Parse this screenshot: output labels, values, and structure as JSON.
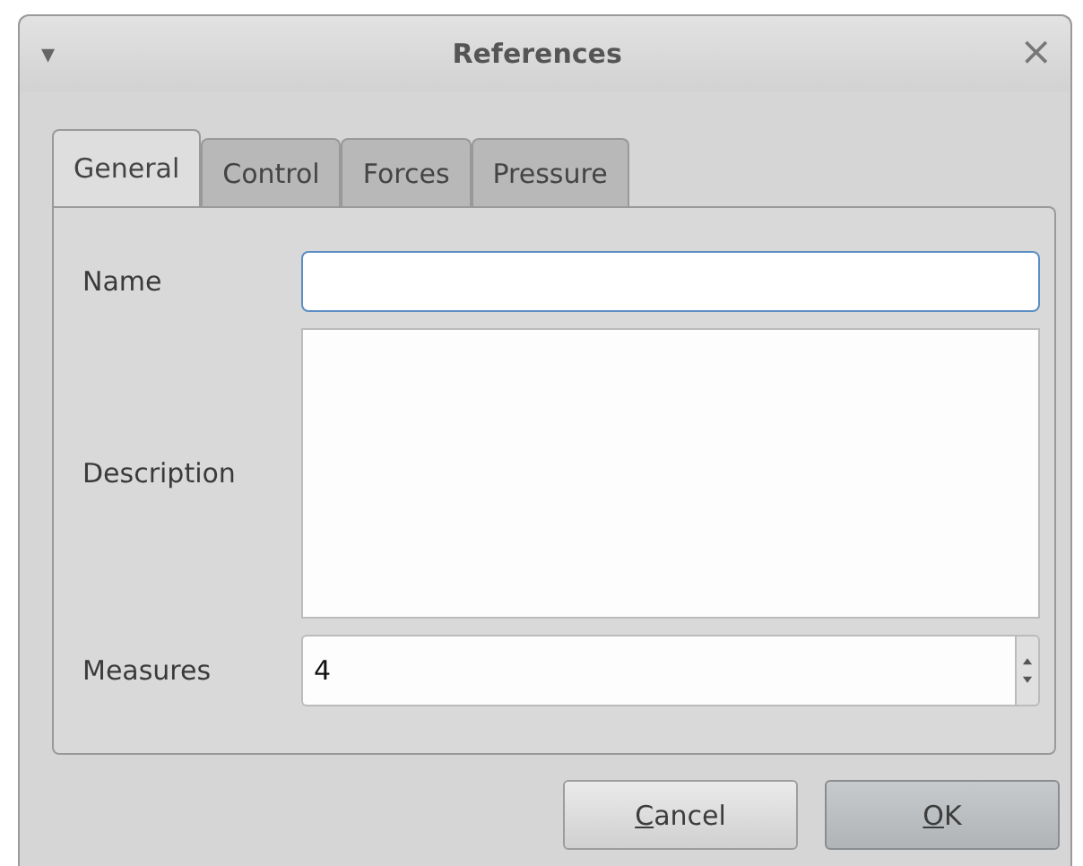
{
  "window": {
    "title": "References",
    "menu_glyph": "▾",
    "close_glyph": "×"
  },
  "tabs": [
    {
      "label": "General",
      "selected": true
    },
    {
      "label": "Control",
      "selected": false
    },
    {
      "label": "Forces",
      "selected": false
    },
    {
      "label": "Pressure",
      "selected": false
    }
  ],
  "fields": [
    {
      "kind": "line",
      "label": "Name"
    },
    {
      "kind": "area",
      "label": "Description"
    },
    {
      "kind": "spin",
      "label": "Measures",
      "value": "4"
    }
  ],
  "buttons": [
    {
      "mnemonic": "C",
      "rest": "ancel",
      "default": false
    },
    {
      "mnemonic": "O",
      "rest": "K",
      "default": true
    }
  ]
}
